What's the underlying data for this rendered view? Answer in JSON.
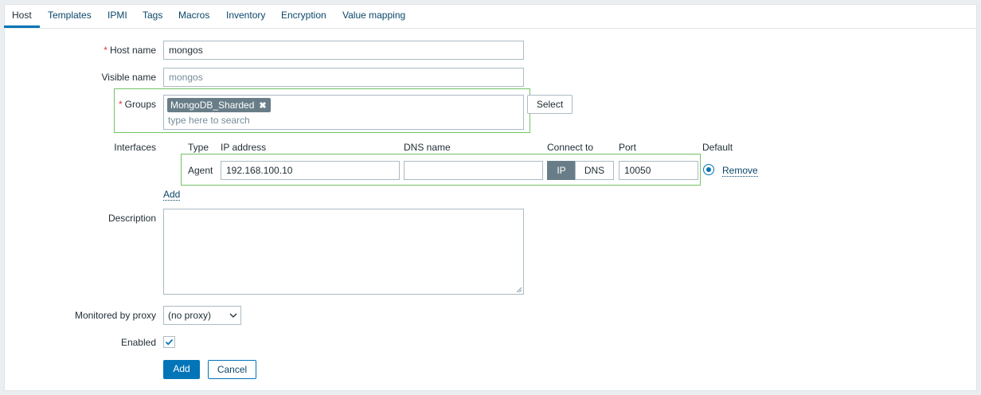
{
  "tabs": [
    {
      "label": "Host",
      "active": true
    },
    {
      "label": "Templates"
    },
    {
      "label": "IPMI"
    },
    {
      "label": "Tags"
    },
    {
      "label": "Macros"
    },
    {
      "label": "Inventory"
    },
    {
      "label": "Encryption"
    },
    {
      "label": "Value mapping"
    }
  ],
  "form": {
    "required_mark": "*",
    "host_name": {
      "label": "Host name",
      "value": "mongos"
    },
    "visible_name": {
      "label": "Visible name",
      "placeholder": "mongos"
    },
    "groups": {
      "label": "Groups",
      "chips": [
        "MongoDB_Sharded"
      ],
      "remove_glyph": "✖",
      "search_placeholder": "type here to search",
      "select_label": "Select"
    },
    "interfaces": {
      "label": "Interfaces",
      "headers": {
        "type": "Type",
        "ip": "IP address",
        "dns": "DNS name",
        "connect": "Connect to",
        "port": "Port",
        "default": "Default"
      },
      "rows": [
        {
          "type": "Agent",
          "ip": "192.168.100.10",
          "dns": "",
          "connect_ip": "IP",
          "connect_dns": "DNS",
          "connect_selected": "IP",
          "port": "10050",
          "default": true,
          "remove_label": "Remove"
        }
      ],
      "add_label": "Add"
    },
    "description": {
      "label": "Description",
      "value": ""
    },
    "proxy": {
      "label": "Monitored by proxy",
      "selected": "(no proxy)"
    },
    "enabled": {
      "label": "Enabled",
      "checked": true
    }
  },
  "actions": {
    "add_label": "Add",
    "cancel_label": "Cancel"
  },
  "colors": {
    "accent": "#0275b8",
    "highlight_box": "#74c365",
    "link": "#0a466a",
    "required": "#e33734"
  }
}
